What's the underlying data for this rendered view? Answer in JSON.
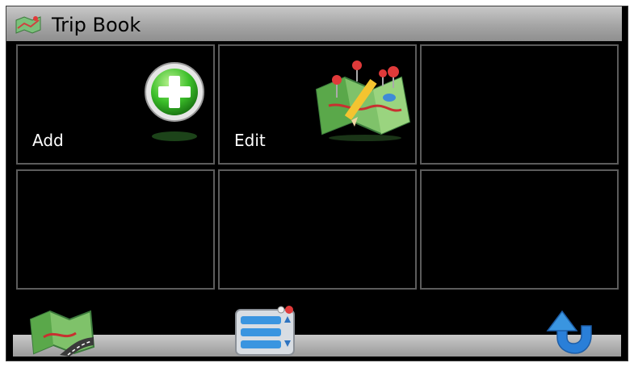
{
  "window": {
    "title": "Trip Book",
    "title_icon": "map-icon"
  },
  "tiles": [
    {
      "label": "Add",
      "icon": "add-plus-icon"
    },
    {
      "label": "Edit",
      "icon": "edit-map-pencil-icon"
    },
    {
      "label": ""
    },
    {
      "label": ""
    },
    {
      "label": ""
    },
    {
      "label": ""
    }
  ],
  "toolbar": {
    "left_icon": "map-road-icon",
    "center_icon": "menu-list-icon",
    "right_icon": "back-arrow-icon"
  },
  "colors": {
    "background": "#000000",
    "tile_border": "#5c5c5c",
    "accent_green": "#3cbf2a",
    "accent_blue": "#2a7fd8"
  }
}
